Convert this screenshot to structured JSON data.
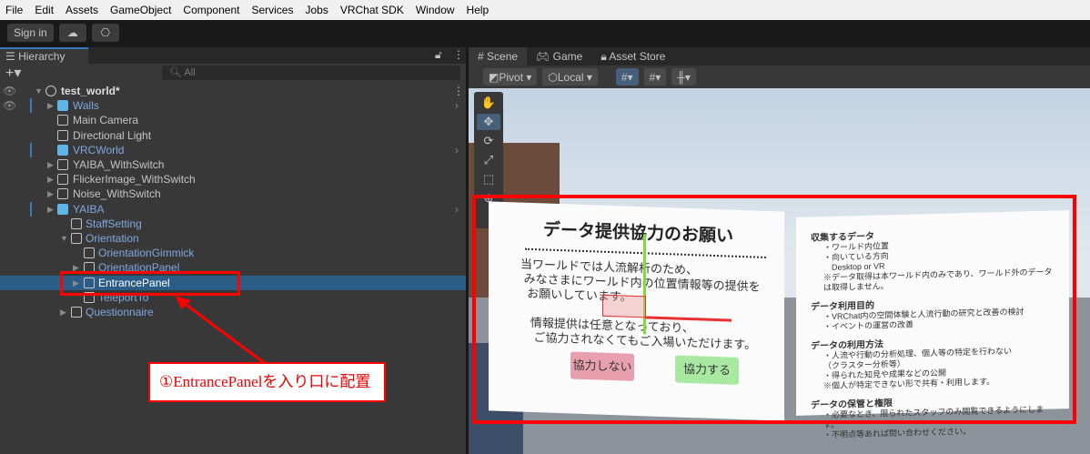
{
  "menu": [
    "File",
    "Edit",
    "Assets",
    "GameObject",
    "Component",
    "Services",
    "Jobs",
    "VRChat SDK",
    "Window",
    "Help"
  ],
  "toolbar": {
    "sign_in": "Sign in",
    "cloud_icon": "cloud-icon",
    "settings_icon": "gear-icon"
  },
  "hierarchy": {
    "tab": "Hierarchy",
    "search_placeholder": "All",
    "rows": [
      {
        "label": "test_world*"
      },
      {
        "label": "Walls"
      },
      {
        "label": "Main Camera"
      },
      {
        "label": "Directional Light"
      },
      {
        "label": "VRCWorld"
      },
      {
        "label": "YAIBA_WithSwitch"
      },
      {
        "label": "FlickerImage_WithSwitch"
      },
      {
        "label": "Noise_WithSwitch"
      },
      {
        "label": "YAIBA"
      },
      {
        "label": "StaffSetting"
      },
      {
        "label": "Orientation"
      },
      {
        "label": "OrientationGimmick"
      },
      {
        "label": "OrientationPanel"
      },
      {
        "label": "EntrancePanel"
      },
      {
        "label": "TeleportTo"
      },
      {
        "label": "Questionnaire"
      }
    ],
    "selected": "EntrancePanel"
  },
  "scene": {
    "tabs": [
      "Scene",
      "Game",
      "Asset Store"
    ],
    "pivot": "Pivot",
    "local": "Local",
    "panel_main": {
      "title": "データ提供協力のお願い",
      "body": "当ワールドでは人流解析のため、\n みなさまにワールド内の位置情報等の提供を\n  お願いしています。\n\n   情報提供は任意となっており、\n    ご協力されなくてもご入場いただけます。",
      "decline": "協力しない",
      "accept": "協力する"
    },
    "panel_info": {
      "sections": [
        {
          "heading": "収集するデータ",
          "lines": [
            "・ワールド内位置",
            "・向いている方向",
            "　Desktop or VR",
            "※データ取得は本ワールド内のみであり、ワールド外のデータは取得しません。"
          ]
        },
        {
          "heading": "データ利用目的",
          "lines": [
            "・VRChat内の空間体験と人流行動の研究と改善の検討",
            "・イベントの運営の改善"
          ]
        },
        {
          "heading": "データの利用方法",
          "lines": [
            "・人流や行動の分析処理、個人等の特定を行わない",
            "（クラスター分析等）",
            "・得られた知見や成果などの公開",
            "※個人が特定できない形で共有・利用します。"
          ]
        },
        {
          "heading": "データの保管と権限",
          "lines": [
            "・必要なとき、限られたスタッフのみ閲覧できるようにします。",
            "・不明点等あれば問い合わせください。"
          ]
        }
      ]
    }
  },
  "annotation": {
    "text": "①EntrancePanelを入り口に配置",
    "color": "#ff0000"
  },
  "colors": {
    "selection": "#2c5d87",
    "prefab": "#7fa8e0",
    "highlight": "#ff0000"
  }
}
